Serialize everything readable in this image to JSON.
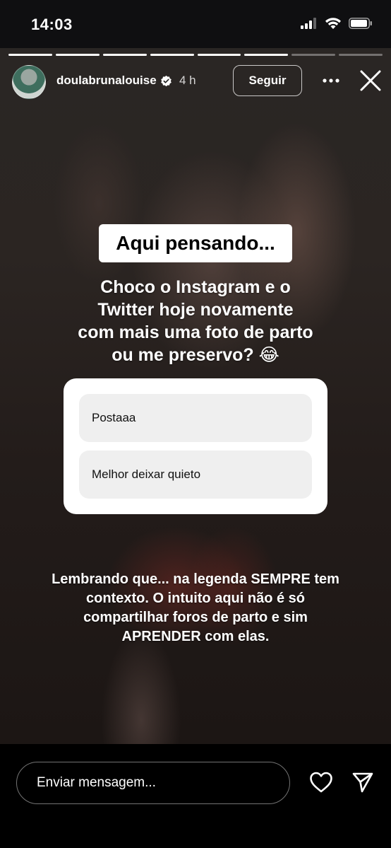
{
  "status_bar": {
    "time": "14:03"
  },
  "story": {
    "progress": {
      "segments": 8,
      "current": 6
    },
    "username": "doulabrunalouise",
    "age": "4 h",
    "follow_label": "Seguir",
    "title_sticker": "Aqui pensando...",
    "question_lines": [
      "Choco o Instagram e o",
      "Twitter hoje novamente",
      "com mais uma foto de parto",
      "ou me preservo? 😂"
    ],
    "poll": {
      "options": [
        "Postaaa",
        "Melhor deixar quieto"
      ]
    },
    "caption_lines": [
      "Lembrando que... na legenda SEMPRE tem",
      "contexto. O intuito aqui não é só",
      "compartilhar foros de parto e sim",
      "APRENDER com elas."
    ]
  },
  "bottom_bar": {
    "message_placeholder": "Enviar mensagem..."
  },
  "icons": {
    "verified": "verified-badge-icon",
    "more": "more-icon",
    "close": "close-icon",
    "like": "heart-icon",
    "share": "send-icon"
  }
}
